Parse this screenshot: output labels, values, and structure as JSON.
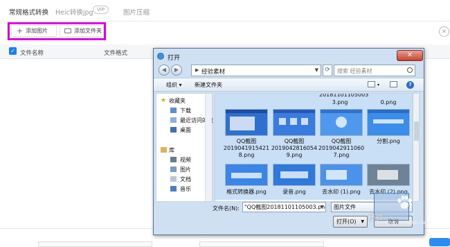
{
  "app": {
    "tabs": [
      {
        "label": "常规格式转换"
      },
      {
        "label": "Heic转换jpg"
      },
      {
        "label": "图片压缩"
      }
    ],
    "vip_badge": "VIP",
    "add_image_label": "添加图片",
    "add_folder_label": "添加文件夹",
    "highlight_color": "#e000e0",
    "table_headers": [
      "文件名称",
      "文件格式"
    ],
    "accent_color": "#1a7ff0"
  },
  "dialog": {
    "title": "打开",
    "path": "经验素材",
    "search_placeholder": "搜索 经验素材",
    "organize_label": "组织",
    "new_folder_label": "新建文件夹",
    "nav": {
      "favorites": "收藏夹",
      "favorites_items": [
        "下载",
        "最近访问的位",
        "桌面"
      ],
      "library": "库",
      "library_items": [
        "视频",
        "图片",
        "文档",
        "音乐"
      ]
    },
    "files": {
      "top_row": [
        "3.png",
        "0.png"
      ],
      "partial_top": "20181101105003",
      "row1": [
        {
          "line1": "QQ截图",
          "line2": "2019041915421",
          "line3": "8.png"
        },
        {
          "line1": "QQ截图",
          "line2": "2019042816054",
          "line3": "9.png"
        },
        {
          "line1": "QQ截图",
          "line2": "2019042911060",
          "line3": "7.png"
        },
        {
          "line1": "分割.png"
        }
      ],
      "row2": [
        "格式转换器.png",
        "录音.png",
        "去水印 (1).png",
        "去水印 (2).png"
      ]
    },
    "filename_label": "文件名(N):",
    "filename_value": "\"QQ截图20181101105003.png\" \"",
    "filetype_value": "图片文件",
    "open_label": "打开(O)",
    "cancel_label": "取消",
    "watermark_text": "经验",
    "watermark_url": "jingyan.baidu.com"
  }
}
